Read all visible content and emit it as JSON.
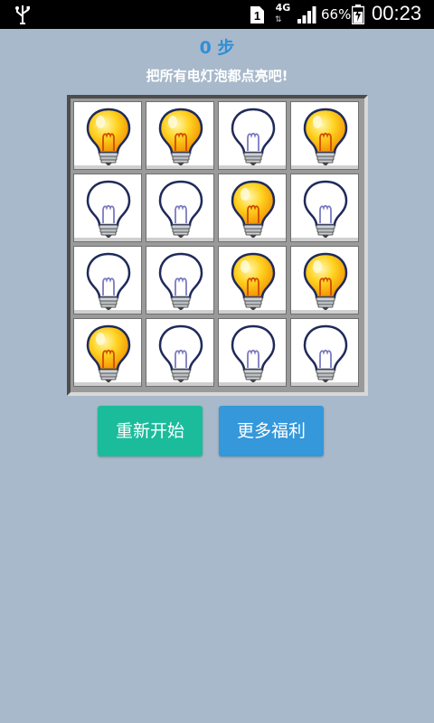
{
  "status_bar": {
    "network_type": "4G",
    "network_arrows": "⇅",
    "battery_percent": "66%",
    "time": "00:23",
    "sim_label": "1"
  },
  "game": {
    "steps": "0 步",
    "instruction": "把所有电灯泡都点亮吧!",
    "grid": [
      [
        true,
        true,
        false,
        true
      ],
      [
        false,
        false,
        true,
        false
      ],
      [
        false,
        false,
        true,
        true
      ],
      [
        true,
        false,
        false,
        false
      ]
    ]
  },
  "buttons": {
    "restart": "重新开始",
    "more": "更多福利"
  },
  "colors": {
    "background": "#a8b9cb",
    "steps_text": "#2f8fd8",
    "restart_button": "#1bbc9b",
    "more_button": "#3498db"
  }
}
